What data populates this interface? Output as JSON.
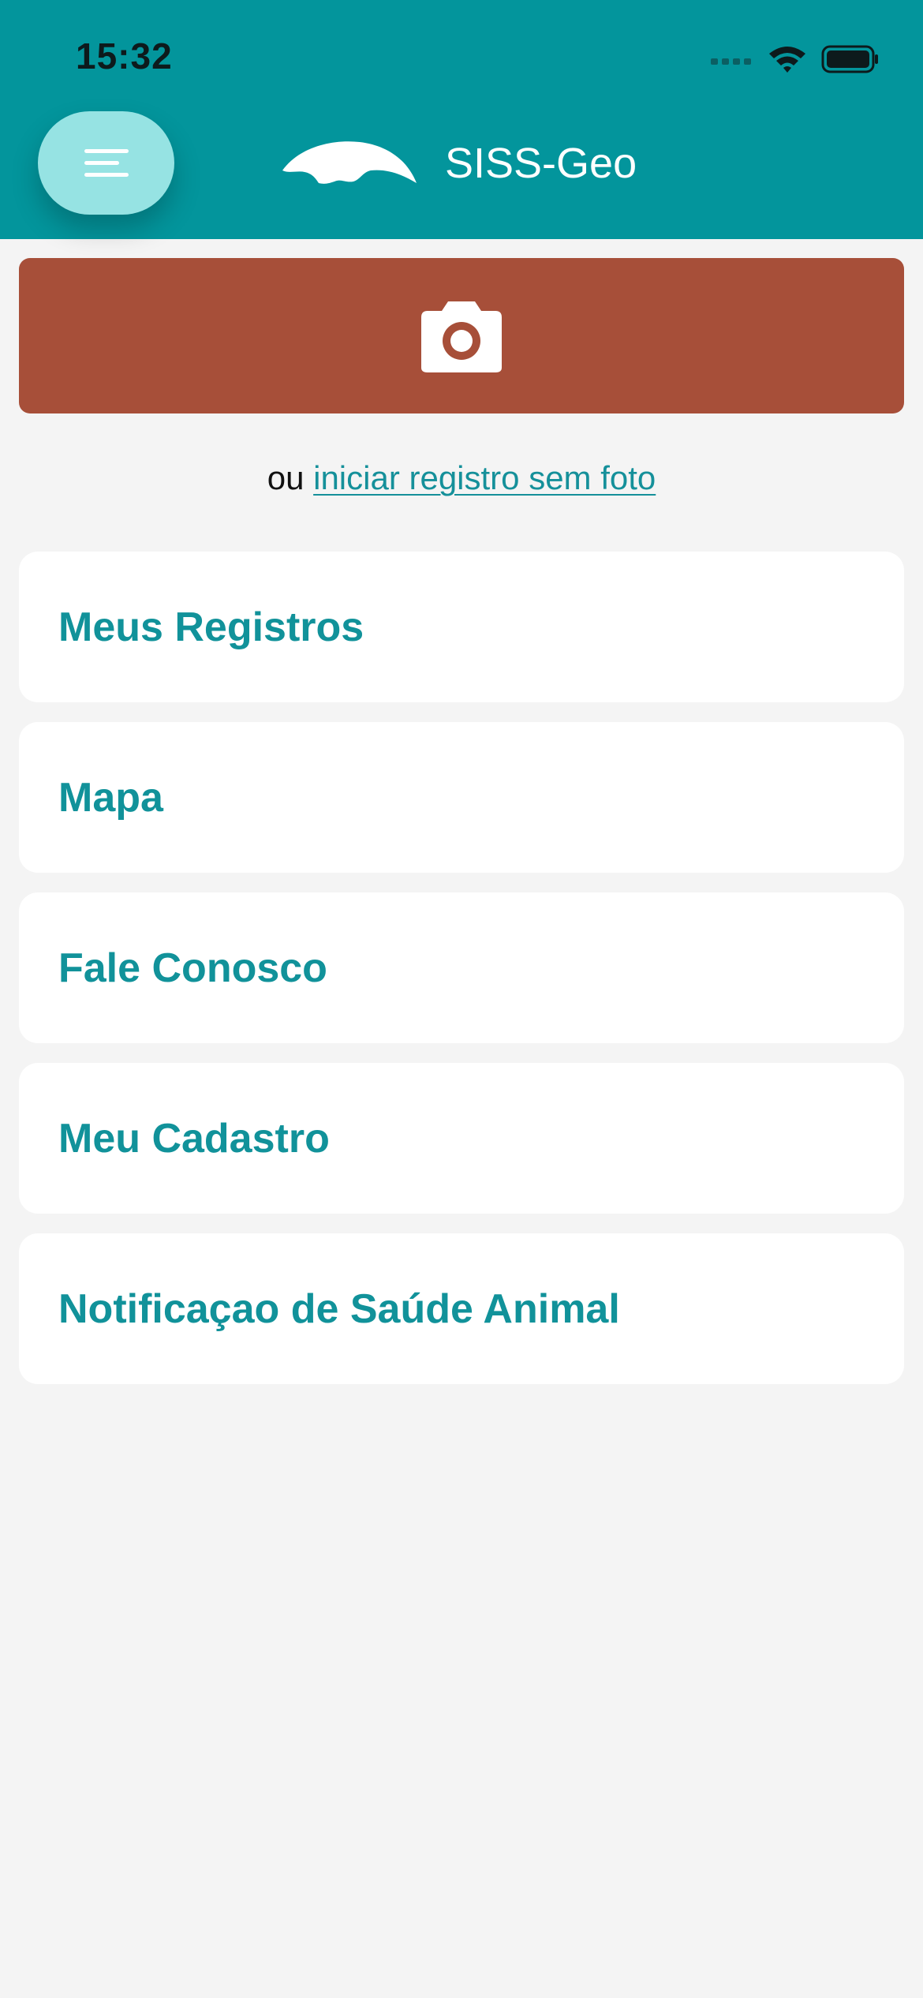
{
  "status_bar": {
    "time": "15:32"
  },
  "header": {
    "title": "SISS-Geo",
    "logo_icon": "animal-silhouette-logo",
    "menu_icon": "hamburger-menu-icon"
  },
  "camera_button": {
    "icon": "camera-icon"
  },
  "no_photo": {
    "prefix": "ou",
    "link_text": "iniciar registro sem foto"
  },
  "menu": {
    "items": [
      {
        "label": "Meus Registros"
      },
      {
        "label": "Mapa"
      },
      {
        "label": "Fale Conosco"
      },
      {
        "label": "Meu Cadastro"
      },
      {
        "label": "Notificaçao de Saúde Animal"
      }
    ]
  },
  "colors": {
    "header_bg": "#03959c",
    "menu_button_bg": "#96e3e3",
    "camera_button_bg": "#a74f39",
    "accent_text": "#11929a",
    "page_bg": "#f4f4f4"
  }
}
